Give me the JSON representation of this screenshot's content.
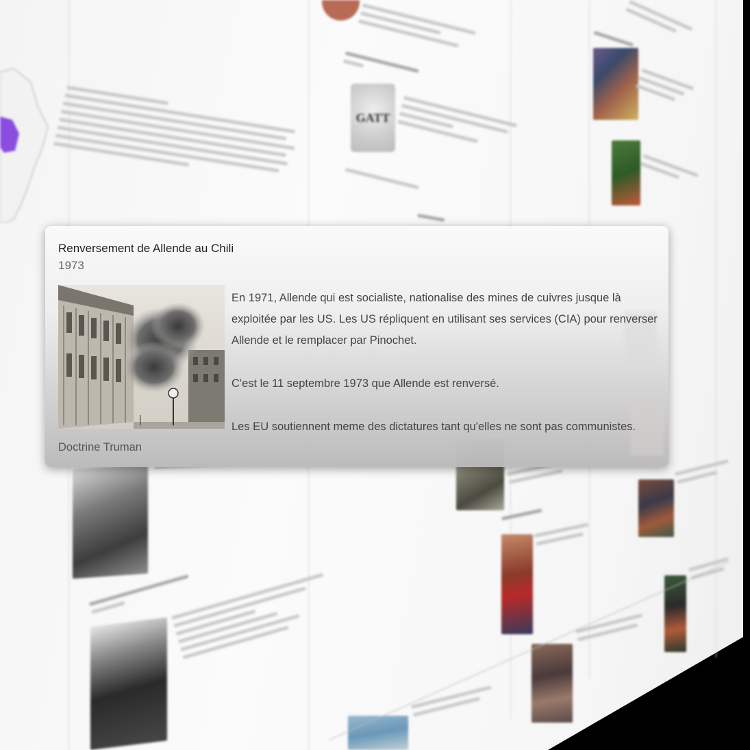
{
  "popup": {
    "title": "Renversement de Allende au Chili",
    "year": "1973",
    "paragraphs": [
      "En 1971, Allende qui est socialiste, nationalise des mines de cuivres jusque là exploitée par les US. Les US répliquent en utilisant ses services (CIA) pour renverser Allende et le remplacer par Pinochet.",
      "C'est le 11 septembre 1973 que Allende est renversé.",
      "Les EU soutiennent meme des dictatures tant qu'elles ne sont pas communistes."
    ],
    "footer": "Doctrine Truman"
  },
  "background": {
    "gatt_logo_text": "GATT"
  },
  "colors": {
    "page_bg": "#f7f7f7",
    "map_highlight": "#8a4de0",
    "card_title": "#222222",
    "card_body": "#444444"
  }
}
